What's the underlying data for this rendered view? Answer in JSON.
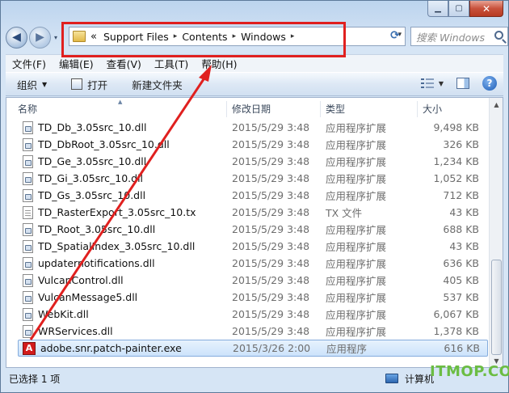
{
  "window": {
    "caption": {
      "min": "▁",
      "max": "▢",
      "close": "✕"
    }
  },
  "nav": {
    "back_icon": "back-arrow-icon",
    "forward_icon": "forward-arrow-icon",
    "history_dropdown": "▾"
  },
  "address": {
    "overflow": "«",
    "crumbs": [
      "Support Files",
      "Contents",
      "Windows"
    ],
    "separator": "▸"
  },
  "search": {
    "placeholder": "搜索 Windows"
  },
  "menu": [
    "文件(F)",
    "编辑(E)",
    "查看(V)",
    "工具(T)",
    "帮助(H)"
  ],
  "commands": {
    "organize": "组织",
    "open": "打开",
    "new_folder": "新建文件夹"
  },
  "columns": {
    "name": "名称",
    "date": "修改日期",
    "type": "类型",
    "size": "大小"
  },
  "files": [
    {
      "name": "TD_Db_3.05src_10.dll",
      "date": "2015/5/29 3:48",
      "type": "应用程序扩展",
      "size": "9,498 KB",
      "icon": "dll"
    },
    {
      "name": "TD_DbRoot_3.05src_10.dll",
      "date": "2015/5/29 3:48",
      "type": "应用程序扩展",
      "size": "326 KB",
      "icon": "dll"
    },
    {
      "name": "TD_Ge_3.05src_10.dll",
      "date": "2015/5/29 3:48",
      "type": "应用程序扩展",
      "size": "1,234 KB",
      "icon": "dll"
    },
    {
      "name": "TD_Gi_3.05src_10.dll",
      "date": "2015/5/29 3:48",
      "type": "应用程序扩展",
      "size": "1,052 KB",
      "icon": "dll"
    },
    {
      "name": "TD_Gs_3.05src_10.dll",
      "date": "2015/5/29 3:48",
      "type": "应用程序扩展",
      "size": "712 KB",
      "icon": "dll"
    },
    {
      "name": "TD_RasterExport_3.05src_10.tx",
      "date": "2015/5/29 3:48",
      "type": "TX 文件",
      "size": "43 KB",
      "icon": "txt"
    },
    {
      "name": "TD_Root_3.05src_10.dll",
      "date": "2015/5/29 3:48",
      "type": "应用程序扩展",
      "size": "688 KB",
      "icon": "dll"
    },
    {
      "name": "TD_SpatialIndex_3.05src_10.dll",
      "date": "2015/5/29 3:48",
      "type": "应用程序扩展",
      "size": "43 KB",
      "icon": "dll"
    },
    {
      "name": "updaternotifications.dll",
      "date": "2015/5/29 3:48",
      "type": "应用程序扩展",
      "size": "636 KB",
      "icon": "dll"
    },
    {
      "name": "VulcanControl.dll",
      "date": "2015/5/29 3:48",
      "type": "应用程序扩展",
      "size": "405 KB",
      "icon": "dll"
    },
    {
      "name": "VulcanMessage5.dll",
      "date": "2015/5/29 3:48",
      "type": "应用程序扩展",
      "size": "537 KB",
      "icon": "dll"
    },
    {
      "name": "WebKit.dll",
      "date": "2015/5/29 3:48",
      "type": "应用程序扩展",
      "size": "6,067 KB",
      "icon": "dll"
    },
    {
      "name": "WRServices.dll",
      "date": "2015/5/29 3:48",
      "type": "应用程序扩展",
      "size": "1,378 KB",
      "icon": "dll"
    },
    {
      "name": "adobe.snr.patch-painter.exe",
      "date": "2015/3/26 2:00",
      "type": "应用程序",
      "size": "616 KB",
      "icon": "exe",
      "selected": true
    }
  ],
  "status": {
    "selected": "已选择 1 项",
    "location": "计算机"
  },
  "watermark": "ITMOP.COM",
  "annotation": {
    "color": "#e0201f",
    "shape": "red-arrow-and-box"
  }
}
